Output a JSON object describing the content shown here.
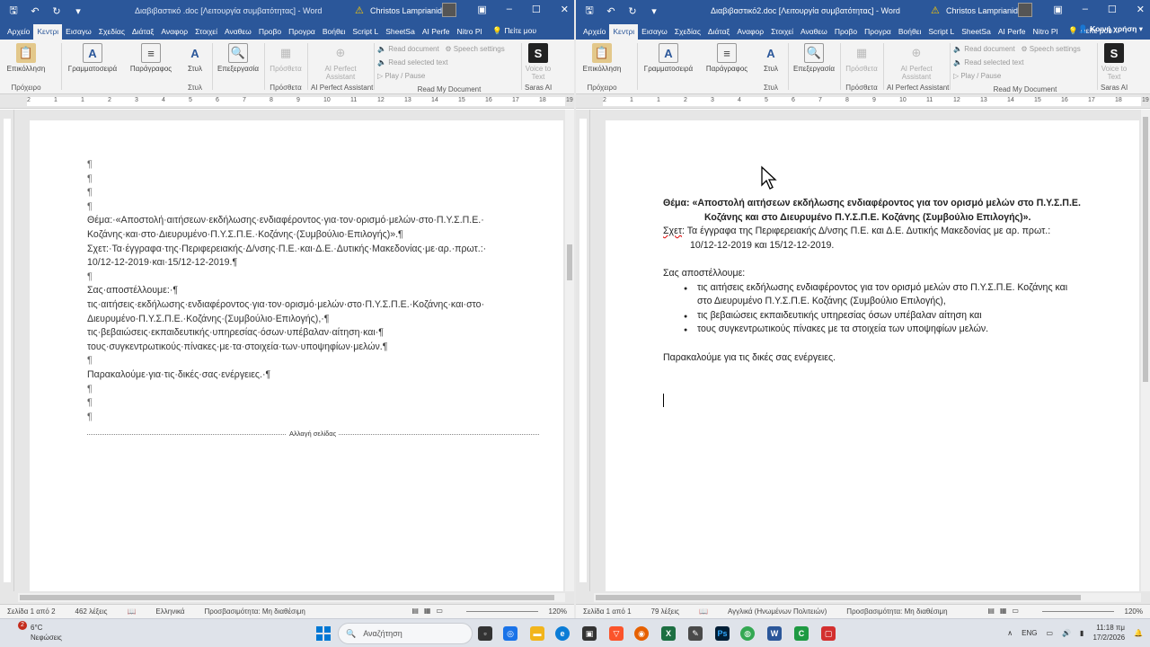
{
  "left": {
    "title": "Διαβιβαστικό .doc [Λειτουργία συμβατότητας] - Word",
    "user": "Christos Lamprianidis",
    "tabs": [
      "Αρχείο",
      "Κεντρι",
      "Εισαγω",
      "Σχεδίας",
      "Διάταξ",
      "Αναφορ",
      "Στοιχεί",
      "Αναθεω",
      "Προβο",
      "Προγρα",
      "Βοήθει",
      "Script L",
      "SheetSa",
      "AI Perfe",
      "Nitro Pl"
    ],
    "tell": "Πείτε μου",
    "share": "",
    "ribbon": {
      "clipboard_btn": "Επικόλληση",
      "clipboard_grp": "Πρόχειρο",
      "font_btn": "Γραμματοσειρά",
      "para_btn": "Παράγραφος",
      "style_btn": "Στυλ",
      "style_grp": "Στυλ",
      "edit_btn": "Επεξεργασία",
      "proofing_btn": "Πρόσθετα",
      "proofing_grp": "Πρόσθετα",
      "aiassist_btn": "AI Perfect Assistant",
      "aiassist_grp": "AI Perfect Assistant",
      "read_doc": "Read document",
      "read_sel": "Read selected text",
      "play": "Play / Pause",
      "speech": "Speech settings",
      "readmy_grp": "Read My Document",
      "voice_btn": "Voice to Text",
      "voice_grp": "Saras AI"
    },
    "lines": [
      "¶",
      "¶",
      "¶",
      "¶",
      "Θέμα:·«Αποστολή·αιτήσεων·εκδήλωσης·ενδιαφέροντος·για·τον·ορισμό·μελών·στο·Π.Υ.Σ.Π.Ε.·",
      "Κοζάνης·και·στο·Διευρυμένο·Π.Υ.Σ.Π.Ε.·Κοζάνης·(Συμβούλιο·Επιλογής)».¶",
      "Σχετ:·Τα·έγγραφα·της·Περιφερειακής·Δ/νσης·Π.Ε.·και·Δ.Ε.·Δυτικής·Μακεδονίας·με·αρ.·πρωτ.:·",
      "10/12-12-2019·και·15/12-12-2019.¶",
      "¶",
      "Σας·αποστέλλουμε:·¶",
      "τις·αιτήσεις·εκδήλωσης·ενδιαφέροντος·για·τον·ορισμό·μελών·στο·Π.Υ.Σ.Π.Ε.·Κοζάνης·και·στο·",
      "Διευρυμένο·Π.Υ.Σ.Π.Ε.·Κοζάνης·(Συμβούλιο·Επιλογής),·¶",
      "τις·βεβαιώσεις·εκπαιδευτικής·υπηρεσίας·όσων·υπέβαλαν·αίτηση·και·¶",
      "τους·συγκεντρωτικούς·πίνακες·με·τα·στοιχεία·των·υποψηφίων·μελών.¶",
      "¶",
      "Παρακαλούμε·για·τις·δικές·σας·ενέργειες.·¶",
      "¶",
      "¶",
      "¶"
    ],
    "page_break": "Αλλαγή σελίδας",
    "status": {
      "page": "Σελίδα 1 από 2",
      "words": "462 λέξεις",
      "lang": "Ελληνικά",
      "access": "Προσβασιμότητα: Μη διαθέσιμη",
      "zoom": "120%"
    }
  },
  "right": {
    "title": "Διαβιβαστικό2.doc [Λειτουργία συμβατότητας] - Word",
    "user": "Christos Lamprianidis",
    "tabs": [
      "Αρχείο",
      "Κεντρι",
      "Εισαγω",
      "Σχεδίας",
      "Διάταξ",
      "Αναφορ",
      "Στοιχεί",
      "Αναθεω",
      "Προβο",
      "Προγρα",
      "Βοήθει",
      "Script L",
      "SheetSa",
      "AI Perfe",
      "Nitro Pl"
    ],
    "tell": "Πείτε μου",
    "share": "Κοινή χρήση",
    "ribbon": {
      "clipboard_btn": "Επικόλληση",
      "clipboard_grp": "Πρόχειρο",
      "font_btn": "Γραμματοσειρά",
      "para_btn": "Παράγραφος",
      "style_btn": "Στυλ",
      "style_grp": "Στυλ",
      "edit_btn": "Επεξεργασία",
      "proofing_btn": "Πρόσθετα",
      "proofing_grp": "Πρόσθετα",
      "aiassist_btn": "AI Perfect Assistant",
      "aiassist_grp": "AI Perfect Assistant",
      "read_doc": "Read document",
      "read_sel": "Read selected text",
      "play": "Play / Pause",
      "speech": "Speech settings",
      "readmy_grp": "Read My Document",
      "voice_btn": "Voice to Text",
      "voice_grp": "Saras AI"
    },
    "subject_1": "Θέμα: «Αποστολή αιτήσεων εκδήλωσης ενδιαφέροντος για τον ορισμό μελών στο Π.Υ.Σ.Π.Ε.",
    "subject_2": "Κοζάνης και στο Διευρυμένο Π.Υ.Σ.Π.Ε. Κοζάνης (Συμβούλιο Επιλογής)».",
    "ref_label": "Σχετ",
    "ref_1": ": Τα έγγραφα της Περιφερειακής Δ/νσης Π.Ε. και Δ.Ε. Δυτικής Μακεδονίας με αρ. πρωτ.:",
    "ref_2": "10/12-12-2019 και 15/12-12-2019.",
    "send": "Σας αποστέλλουμε:",
    "bullet_1a": "τις αιτήσεις εκδήλωσης ενδιαφέροντος για τον ορισμό μελών στο Π.Υ.Σ.Π.Ε. Κοζάνης και",
    "bullet_1b": "στο Διευρυμένο Π.Υ.Σ.Π.Ε. Κοζάνης (Συμβούλιο Επιλογής),",
    "bullet_2": "τις βεβαιώσεις εκπαιδευτικής υπηρεσίας όσων υπέβαλαν αίτηση και",
    "bullet_3": "τους συγκεντρωτικούς πίνακες με τα στοιχεία των υποψηφίων μελών.",
    "closing": "Παρακαλούμε για τις δικές σας ενέργειες.",
    "status": {
      "page": "Σελίδα 1 από 1",
      "words": "79 λέξεις",
      "lang": "Αγγλικά (Ηνωμένων Πολιτειών)",
      "access": "Προσβασιμότητα: Μη διαθέσιμη",
      "zoom": "120%"
    }
  },
  "taskbar": {
    "weather_temp": "6°C",
    "weather_desc": "Νεφώσεις",
    "notif_count": "2",
    "search_placeholder": "Αναζήτηση",
    "lang": "ENG",
    "time": "11:18 πμ",
    "date": "17/2/2026"
  },
  "ruler_nums": [
    "2",
    "1",
    "1",
    "2",
    "3",
    "4",
    "5",
    "6",
    "7",
    "8",
    "9",
    "10",
    "11",
    "12",
    "13",
    "14",
    "15",
    "16",
    "17",
    "18",
    "19"
  ]
}
